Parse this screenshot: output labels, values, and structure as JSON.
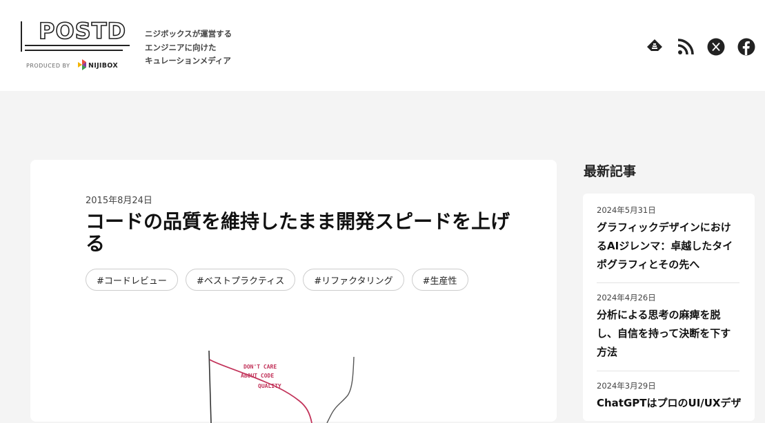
{
  "header": {
    "logo_text": "POSTD",
    "produced_by": "PRODUCED BY",
    "nijibox": "NIJIBOX",
    "tagline": [
      "ニジボックスが運営する",
      "エンジニアに向けた",
      "キュレーションメディア"
    ],
    "social": [
      {
        "icon": "feedly-icon"
      },
      {
        "icon": "rss-icon"
      },
      {
        "icon": "x-icon"
      },
      {
        "icon": "facebook-icon"
      }
    ]
  },
  "article": {
    "date": "2015年8月24日",
    "title": "コードの品質を維持したまま開発スピードを上げる",
    "tags": [
      "#コードレビュー",
      "#ベストプラクティス",
      "#リファクタリング",
      "#生産性"
    ],
    "illustration_text": [
      "DON'T CARE",
      "ABOUT CODE",
      "QUALITY"
    ]
  },
  "sidebar": {
    "heading": "最新記事",
    "items": [
      {
        "date": "2024年5月31日",
        "title": "グラフィックデザインにおけるAIジレンマ：卓越したタイポグラフィとその先へ"
      },
      {
        "date": "2024年4月26日",
        "title": "分析による思考の麻痺を脱し、自信を持って決断を下す方法"
      },
      {
        "date": "2024年3月29日",
        "title": "ChatGPTはプロのUI/UXデザ"
      }
    ]
  },
  "colors": {
    "accent_red": "#c2335a",
    "background": "#f4f4f4"
  }
}
